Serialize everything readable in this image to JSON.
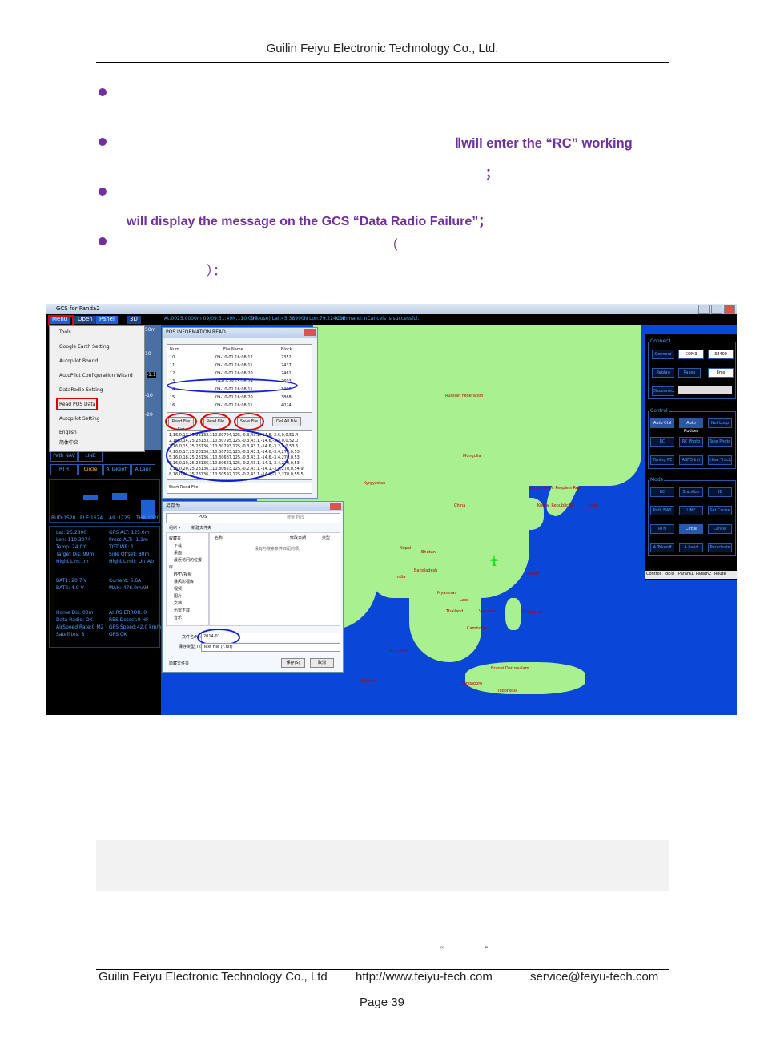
{
  "header": {
    "company": "Guilin Feiyu Electronic Technology Co., Ltd."
  },
  "body": {
    "p2_fragment": "Ⅱwill  enter  the  “RC”  working",
    "p2_end": "；",
    "p3_text": "will display the message on the GCS “Data Radio Failure”；",
    "p4_open": "（",
    "p4_close": "）："
  },
  "screenshot": {
    "title": "GCS for Panda2",
    "menu": [
      "Menu",
      "Open",
      "Panel",
      "3D"
    ],
    "status": {
      "coords": "At:0025.0000m  09/09:51:49N,110:097",
      "position": "(mouse) Lat:45.38990N Lon:79.22400E",
      "command": "Command: nCancels is successful."
    },
    "dropdown": [
      "Tools",
      "Google Earth Setting",
      "Autopilot Bound",
      "AutoPilot Configuration Wizard",
      "DataRadio Setting",
      "Read POS Data",
      "Autopilot Setting",
      "English",
      "简体中文"
    ],
    "gauge_labels": [
      "50m",
      "10",
      "-1.1",
      "-10",
      "-20"
    ],
    "nav_buttons": [
      "Path NAV",
      "LINE",
      "RTH",
      "Circle",
      "A Takeoff",
      "A Land"
    ],
    "bar_labels": [
      "RUD:1528",
      "ELE:1674",
      "AIL:1725",
      "THR:1020"
    ],
    "telemetry_left": [
      "Lat: 25.2800",
      "Lon: 110.3074",
      "Temp: 24.0'C",
      "Target Dis: 99m",
      "Hight Lim: .m",
      "BAT1: 20.7 V",
      "BAT2: 4.9 V",
      "Home Dis: 00m",
      "Data Radio: OK",
      "AirSpeed Rate:0 M2",
      "Satellites: 8"
    ],
    "telemetry_right": [
      "GPS ALT: 125.0m",
      "Press ALT: -1.1m",
      "TGT WP: 1",
      "Side Offset: 80m",
      "Hight Limit: Un_Ab",
      "Current: 6.6A",
      "MAH: 476.0mAH",
      "AHRS ERROR: 0",
      "RES Detect:0 HF",
      "GPS Speed:42.0 km/h",
      "GPS OK"
    ],
    "pos_dialog": {
      "title": "POS INFORMATION READ",
      "headers": [
        "Num",
        "File Name",
        "Block"
      ],
      "rows": [
        [
          "10",
          "09-10-01 16:08:12",
          "2352"
        ],
        [
          "11",
          "09-10-01 16:08:11",
          "2437"
        ],
        [
          "12",
          "09-10-01 16:08:20",
          "2461"
        ],
        [
          "13",
          "14-07-29 15:08:24",
          "2603"
        ],
        [
          "14",
          "09-10-01 16:08:11",
          "3496"
        ],
        [
          "15",
          "09-10-01 16:08:20",
          "3868"
        ],
        [
          "16",
          "09-10-01 16:08:11",
          "4024"
        ]
      ],
      "buttons": [
        "Read File List",
        "Read File",
        "Save File",
        "Del All File"
      ],
      "data_lines": [
        "1,16,0,13,25.28132,110.30794,125,-0.3,43.1,-14.6,-3.6,0,0,51.4",
        "2,16,0,14,25.28133,110.30795,125,-0.3,43.1,-14.6,-3.3,0,0,52.0",
        "3,16,0,15,25.28136,110.30793,125,-0.3,43.1,-14.6,-3.2,0,0,53.5",
        "4,16,0,17,25.28136,110.30733,125,-0.3,43.1,-14.6,-3.4,270,0,53",
        "5,16,0,18,25.28136,110.30687,125,-0.3,43.1,-14.6,-3.4,270,0,53",
        "6,16,0,19,25.28136,110.30661,125,-0.2,43.1,-14.1,-3.4,270,0,53",
        "7,16,0,20,25.28136,110.30623,125,-0.2,43.1,-14.1,-3.4,270,0,54.9",
        "8,16,0,21,25.28136,110.30592,125,-0.2,43.1,-14.1,-3.2,270,0,55.5"
      ],
      "status": "Start Read File!"
    },
    "save_dialog": {
      "title": "另存为",
      "path": "POS",
      "search": "搜索 POS",
      "toolbar": [
        "组织 ▾",
        "新建文件夹"
      ],
      "sidebar": [
        "收藏夹",
        "下载",
        "桌面",
        "最近访问的位置",
        "库",
        "PPTV视频",
        "暴风影视库",
        "视频",
        "图片",
        "文档",
        "迅雷下载",
        "音乐"
      ],
      "columns": [
        "名称",
        "修改日期",
        "类型"
      ],
      "empty_msg": "没有与搜索条件匹配的项。",
      "filename_label": "文件名(N):",
      "filename": "2014-01",
      "type_label": "保存类型(T):",
      "type": "Text File (*.txt)",
      "hide": "隐藏文件夹",
      "save_btn": "保存(S)",
      "cancel_btn": "取消"
    },
    "map_labels": [
      "Russian Federation",
      "Mongolia",
      "China",
      "Kyrgyzstan",
      "Korea, Dem. People's Rep.",
      "Korea, Republic Of",
      "Japan",
      "Nepal",
      "Bhutan",
      "Bangladesh",
      "India",
      "Myanmar",
      "Taiwan",
      "Laos",
      "Thailand",
      "Vietnam",
      "Philippines",
      "Cambodia",
      "Sri Lanka",
      "Brunei Darussalam",
      "Singapore",
      "Indonesia",
      "Maldives"
    ],
    "right_panel": {
      "connect_label": "Connect",
      "connect_buttons": [
        "Connect",
        "COM3",
        "38400",
        "Replay",
        "Pause",
        "8ms",
        "Disconnect"
      ],
      "control_label": "Control",
      "control_buttons": [
        "Auto Ctrl",
        "Auto Rudder",
        "Not Loop",
        "RC",
        "RC Photo",
        "Take Photo",
        "Timing PE",
        "ASFO Init",
        "Clear Track"
      ],
      "mode_label": "Mode",
      "mode_buttons": [
        "RC",
        "Stabilize",
        "3D",
        "Path NAV",
        "LINE",
        "Set Cruise",
        "RTH",
        "Circle",
        "Cancel",
        "A Takeoff",
        "A Land",
        "Parachute"
      ],
      "tabs": [
        "Control",
        "Tools",
        "Param1",
        "Param2",
        "Route"
      ]
    }
  },
  "bottom": {
    "quote_open": "“",
    "quote_close": "”"
  },
  "footer": {
    "company": "Guilin Feiyu Electronic Technology Co., Ltd",
    "url": "http://www.feiyu-tech.com",
    "email": "service@feiyu-tech.com",
    "page": "Page 39"
  }
}
